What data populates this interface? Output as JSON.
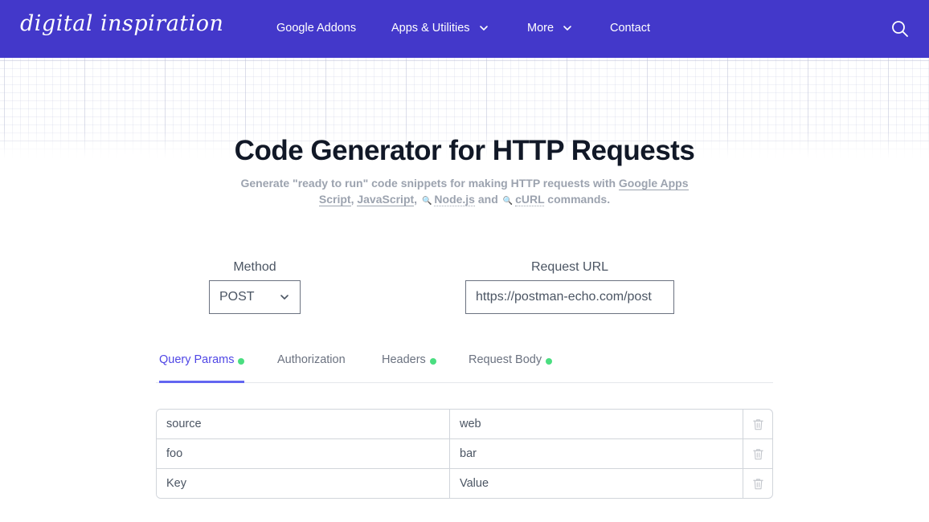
{
  "navbar": {
    "logo": "digital inspiration",
    "items": [
      {
        "label": "Google Addons",
        "has_dropdown": false
      },
      {
        "label": "Apps & Utilities",
        "has_dropdown": true
      },
      {
        "label": "More",
        "has_dropdown": true
      },
      {
        "label": "Contact",
        "has_dropdown": false
      }
    ],
    "search_icon": "search-icon",
    "color": "#4338ca"
  },
  "header": {
    "title": "Code Generator for HTTP Requests",
    "subtitle": {
      "prefix": "Generate \"ready to run\" code snippets for making HTTP requests with ",
      "link_gas": "Google Apps Script",
      "sep1": ", ",
      "link_js": "JavaScript",
      "sep2": ", ",
      "link_node": "Node.js",
      "and": " and ",
      "link_curl": "cURL",
      "suffix": " commands."
    }
  },
  "form": {
    "method_label": "Method",
    "method_value": "POST",
    "url_label": "Request URL",
    "url_value": "https://postman-echo.com/post"
  },
  "tabs": [
    {
      "label": "Query Params",
      "active": true,
      "indicator": true
    },
    {
      "label": "Authorization",
      "active": false,
      "indicator": false
    },
    {
      "label": "Headers",
      "active": false,
      "indicator": true
    },
    {
      "label": "Request Body",
      "active": false,
      "indicator": true
    }
  ],
  "params": {
    "rows": [
      {
        "key": "source",
        "value": "web"
      },
      {
        "key": "foo",
        "value": "bar"
      },
      {
        "key": "",
        "value": ""
      }
    ],
    "key_placeholder": "Key",
    "value_placeholder": "Value"
  },
  "colors": {
    "accent": "#4f46e5",
    "indicator": "#4ade80"
  }
}
